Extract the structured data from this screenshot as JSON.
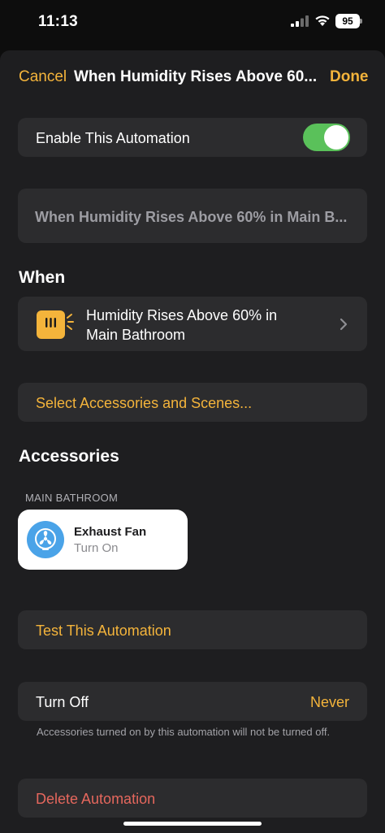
{
  "status_bar": {
    "time": "11:13",
    "battery": "95",
    "icons": [
      "cellular-signal-icon",
      "wifi-icon",
      "battery-icon"
    ]
  },
  "nav": {
    "cancel_label": "Cancel",
    "title": "When Humidity Rises Above 60...",
    "done_label": "Done"
  },
  "enable_row": {
    "label": "Enable This Automation",
    "enabled": true
  },
  "name_field": {
    "value": "When Humidity Rises Above 60% in Main B..."
  },
  "when_section": {
    "title": "When",
    "trigger_line1": "Humidity Rises Above 60% in",
    "trigger_line2": "Main Bathroom",
    "trigger_icon": "humidity-sensor-icon"
  },
  "select_accessories": {
    "label": "Select Accessories and Scenes..."
  },
  "accessories_section": {
    "title": "Accessories",
    "group_label": "MAIN BATHROOM",
    "items": [
      {
        "name": "Exhaust Fan",
        "state": "Turn On",
        "icon": "fan-icon"
      }
    ]
  },
  "test_automation": {
    "label": "Test This Automation"
  },
  "turn_off": {
    "label": "Turn Off",
    "value": "Never",
    "footnote": "Accessories turned on by this automation will not be turned off."
  },
  "delete_automation": {
    "label": "Delete Automation"
  },
  "colors": {
    "accent": "#f4b43b",
    "destructive": "#e5675d",
    "toggle_on": "#5ac15a",
    "card_bg": "#2c2c2e",
    "sheet_bg": "#1e1e20"
  }
}
